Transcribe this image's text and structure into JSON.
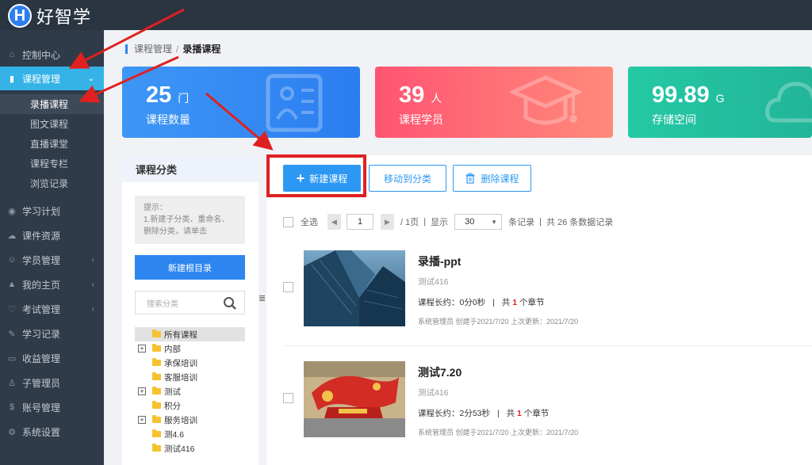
{
  "app": {
    "logo_letter": "H",
    "name": "好智学"
  },
  "sidebar": {
    "items": [
      {
        "icon": "home-icon",
        "label": "控制中心"
      },
      {
        "icon": "book-icon",
        "label": "课程管理"
      },
      {
        "icon": "eye-icon",
        "label": "学习计划"
      },
      {
        "icon": "cloud-icon",
        "label": "课件资源"
      },
      {
        "icon": "users-icon",
        "label": "学员管理"
      },
      {
        "icon": "graduation-cap-icon",
        "label": "我的主页"
      },
      {
        "icon": "heart-icon",
        "label": "考试管理"
      },
      {
        "icon": "edit-icon",
        "label": "学习记录"
      },
      {
        "icon": "credit-card-icon",
        "label": "收益管理"
      },
      {
        "icon": "user-icon",
        "label": "子管理员"
      },
      {
        "icon": "dollar-icon",
        "label": "账号管理"
      },
      {
        "icon": "gear-icon",
        "label": "系统设置"
      }
    ],
    "subitems": [
      "录播课程",
      "图文课程",
      "直播课堂",
      "课程专栏",
      "浏览记录"
    ]
  },
  "breadcrumb": {
    "parent": "课程管理",
    "sep": "/",
    "current": "录播课程"
  },
  "stats": [
    {
      "value": "25",
      "unit": "门",
      "label": "课程数量",
      "color": "#2d86f0"
    },
    {
      "value": "39",
      "unit": "人",
      "label": "课程学员",
      "color": "#ff6b7a"
    },
    {
      "value": "99.89",
      "unit": "G",
      "label": "存储空间",
      "color": "#22c2a2"
    }
  ],
  "category": {
    "title": "课程分类",
    "tips": "提示：\n1.新建子分类、重命名、删除分类，请单击",
    "new_root": "新建根目录",
    "search_placeholder": "搜索分类",
    "tree": [
      {
        "label": "所有课程",
        "expandable": false
      },
      {
        "label": "内部",
        "expandable": true
      },
      {
        "label": "承保培训",
        "expandable": false
      },
      {
        "label": "客服培训",
        "expandable": false
      },
      {
        "label": "测试",
        "expandable": true
      },
      {
        "label": "积分",
        "expandable": false
      },
      {
        "label": "服务培训",
        "expandable": true
      },
      {
        "label": "测4.6",
        "expandable": false
      },
      {
        "label": "测试416",
        "expandable": false
      }
    ],
    "toggle": "≣"
  },
  "toolbar": {
    "new_course": "新建课程",
    "move_to_category": "移动到分类",
    "delete_course": "删除课程"
  },
  "pager": {
    "select_all": "全选",
    "page": "1",
    "total_pages": "/ 1页",
    "show": "显示",
    "page_size": "30",
    "per_page": "条记录",
    "total": "共 26 条数据记录",
    "sep": "|"
  },
  "courses": [
    {
      "title": "录播-ppt",
      "category": "测试416",
      "duration_label": "课程长约：0分0秒",
      "chapters_pre": "共",
      "chapters": "1",
      "chapters_post": "个章节",
      "meta": "系统管理员 创建于2021/7/20 上次更新：2021/7/20"
    },
    {
      "title": "测试7.20",
      "category": "测试416",
      "duration_label": "课程长约：2分53秒",
      "chapters_pre": "共",
      "chapters": "1",
      "chapters_post": "个章节",
      "meta": "系统管理员 创建于2021/7/20 上次更新：2021/7/20"
    }
  ],
  "colors": {
    "accent": "#2d98f3",
    "sidebar_active": "#35b3e6",
    "annotation": "#e02020"
  }
}
